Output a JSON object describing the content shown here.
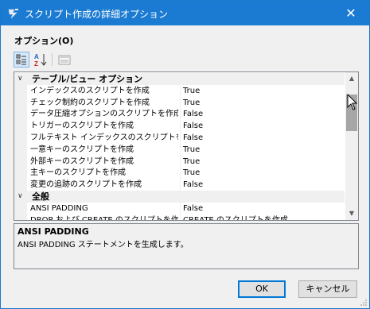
{
  "window": {
    "title": "スクリプト作成の詳細オプション",
    "close_label": "✕"
  },
  "options_label": "オプション(O)",
  "toolbar": {
    "categorized": "categorized-view-icon",
    "alphabetical": "sort-alphabetical-icon",
    "property_pages": "property-pages-icon"
  },
  "grid": {
    "rows": [
      {
        "type": "category",
        "name": "テーブル/ビュー オプション"
      },
      {
        "type": "property",
        "name": "インデックスのスクリプトを作成",
        "value": "True"
      },
      {
        "type": "property",
        "name": "チェック制約のスクリプトを作成",
        "value": "True"
      },
      {
        "type": "property",
        "name": "データ圧縮オプションのスクリプトを作成",
        "value": "False"
      },
      {
        "type": "property",
        "name": "トリガーのスクリプトを作成",
        "value": "False"
      },
      {
        "type": "property",
        "name": "フルテキスト インデックスのスクリプトを作成",
        "value": "False"
      },
      {
        "type": "property",
        "name": "一意キーのスクリプトを作成",
        "value": "True"
      },
      {
        "type": "property",
        "name": "外部キーのスクリプトを作成",
        "value": "True"
      },
      {
        "type": "property",
        "name": "主キーのスクリプトを作成",
        "value": "True"
      },
      {
        "type": "property",
        "name": "変更の追跡のスクリプトを作成",
        "value": "False"
      },
      {
        "type": "category",
        "name": "全般"
      },
      {
        "type": "property",
        "name": "ANSI PADDING",
        "value": "False"
      },
      {
        "type": "property",
        "name": "DROP および CREATE のスクリプトを作成",
        "value": "CREATE のスクリプトを作成"
      }
    ]
  },
  "description": {
    "title": "ANSI PADDING",
    "text": "ANSI PADDING ステートメントを生成します。"
  },
  "buttons": {
    "ok": "OK",
    "cancel": "キャンセル"
  }
}
